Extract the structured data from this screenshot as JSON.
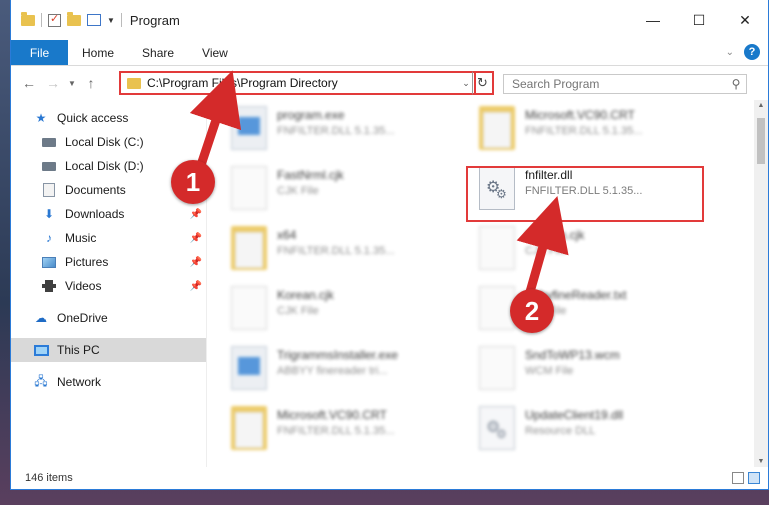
{
  "window": {
    "title": "Program",
    "controls": {
      "minimize": "—",
      "maximize": "☐",
      "close": "✕"
    }
  },
  "ribbon": {
    "file": "File",
    "tabs": [
      "Home",
      "Share",
      "View"
    ],
    "help": "?"
  },
  "address": {
    "path": "C:\\Program Files\\Program Directory",
    "search_placeholder": "Search Program"
  },
  "nav": {
    "quick_access": "Quick access",
    "items": [
      {
        "label": "Local Disk (C:)",
        "icon": "disk-icon",
        "pinned": false
      },
      {
        "label": "Local Disk (D:)",
        "icon": "disk-icon",
        "pinned": false
      },
      {
        "label": "Documents",
        "icon": "document-icon",
        "pinned": false
      },
      {
        "label": "Downloads",
        "icon": "download-icon",
        "pinned": true
      },
      {
        "label": "Music",
        "icon": "music-icon",
        "pinned": true
      },
      {
        "label": "Pictures",
        "icon": "picture-icon",
        "pinned": true
      },
      {
        "label": "Videos",
        "icon": "video-icon",
        "pinned": true
      }
    ],
    "onedrive": "OneDrive",
    "this_pc": "This PC",
    "network": "Network"
  },
  "files": [
    {
      "name": "program.exe",
      "desc": "FNFILTER.DLL 5.1.35...",
      "type": "exe"
    },
    {
      "name": "Microsoft.VC90.CRT",
      "desc": "FNFILTER.DLL 5.1.35...",
      "type": "folder"
    },
    {
      "name": "FastNrml.cjk",
      "desc": "CJK File",
      "type": "page"
    },
    {
      "name": "fnfilter.dll",
      "desc": "FNFILTER.DLL 5.1.35...",
      "type": "dll"
    },
    {
      "name": "x64",
      "desc": "FNFILTER.DLL 5.1.35...",
      "type": "folder"
    },
    {
      "name": "Custom.cjk",
      "desc": "CJK File",
      "type": "page"
    },
    {
      "name": "Korean.cjk",
      "desc": "CJK File",
      "type": "page"
    },
    {
      "name": "AbbyfineReader.txt",
      "desc": "TXT File",
      "type": "page"
    },
    {
      "name": "TrigrammsInstaller.exe",
      "desc": "ABBYY finereader tri...",
      "type": "exe"
    },
    {
      "name": "SndToWP13.wcm",
      "desc": "WCM File",
      "type": "page"
    },
    {
      "name": "Microsoft.VC90.CRT",
      "desc": "FNFILTER.DLL 5.1.35...",
      "type": "folder"
    },
    {
      "name": "UpdateClient19.dll",
      "desc": "Resource DLL",
      "type": "dll"
    }
  ],
  "status": {
    "count": "146 items"
  },
  "callouts": {
    "step1": "1",
    "step2": "2"
  },
  "colors": {
    "accent": "#1979ca",
    "callout": "#d42a2a",
    "highlight": "#e23a3a"
  }
}
